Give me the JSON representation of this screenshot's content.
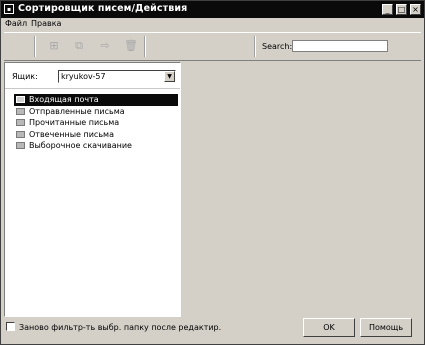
{
  "window": {
    "title": "Сортировщик писем/Действия",
    "controls": {
      "minimize": "_",
      "maximize": "□",
      "close": "×"
    }
  },
  "menu": [
    "Файл",
    "Правка"
  ],
  "toolbar": {
    "icons": [
      "new-filter-icon",
      "copy-filter-icon",
      "move-filter-icon",
      "delete-icon"
    ],
    "search_label": "Search:",
    "search_value": ""
  },
  "mailbox": {
    "label": "Ящик:",
    "value": "kryukov-57"
  },
  "folders": [
    {
      "label": "Входящая почта",
      "selected": true
    },
    {
      "label": "Отправленные письма",
      "selected": false
    },
    {
      "label": "Прочитанные письма",
      "selected": false
    },
    {
      "label": "Отвеченные письма",
      "selected": false
    },
    {
      "label": "Выборочное скачивание",
      "selected": false
    }
  ],
  "footer": {
    "checkbox_label": "Заново фильтр-ть выбр. папку после редактир.",
    "checkbox_checked": false,
    "ok_label": "OK",
    "help_label": "Помощь"
  }
}
